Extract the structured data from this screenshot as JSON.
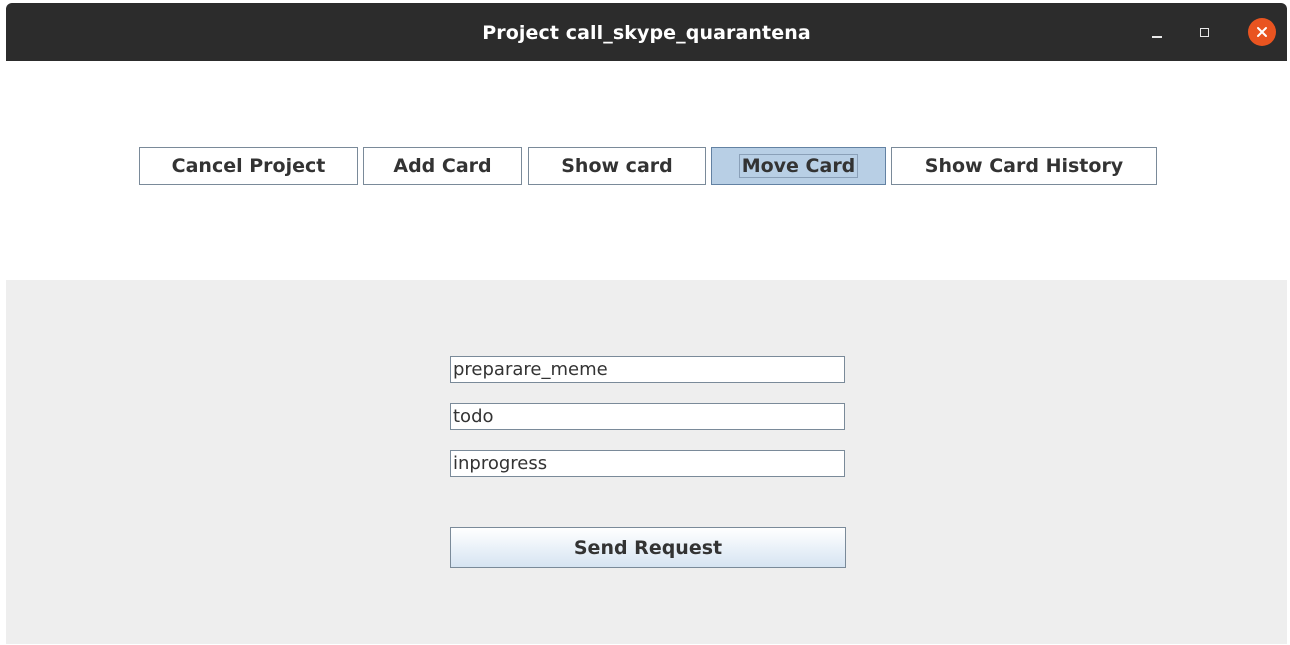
{
  "window": {
    "title": "Project call_skype_quarantena",
    "controls": {
      "minimize_icon": "minimize-icon",
      "maximize_icon": "maximize-icon",
      "close_icon": "close-icon",
      "close_color": "#e95420"
    }
  },
  "toolbar": {
    "buttons": [
      {
        "label": "Cancel Project",
        "active": false
      },
      {
        "label": "Add Card",
        "active": false
      },
      {
        "label": "Show card",
        "active": false
      },
      {
        "label": "Move Card",
        "active": true
      },
      {
        "label": "Show Card History",
        "active": false
      }
    ]
  },
  "form": {
    "card_name": "preparare_meme",
    "source_list": "todo",
    "destination_list": "inprogress",
    "submit_label": "Send Request"
  },
  "colors": {
    "titlebar": "#2c2c2c",
    "active_button": "#b8cfe5",
    "panel_background": "#eeeeee"
  }
}
